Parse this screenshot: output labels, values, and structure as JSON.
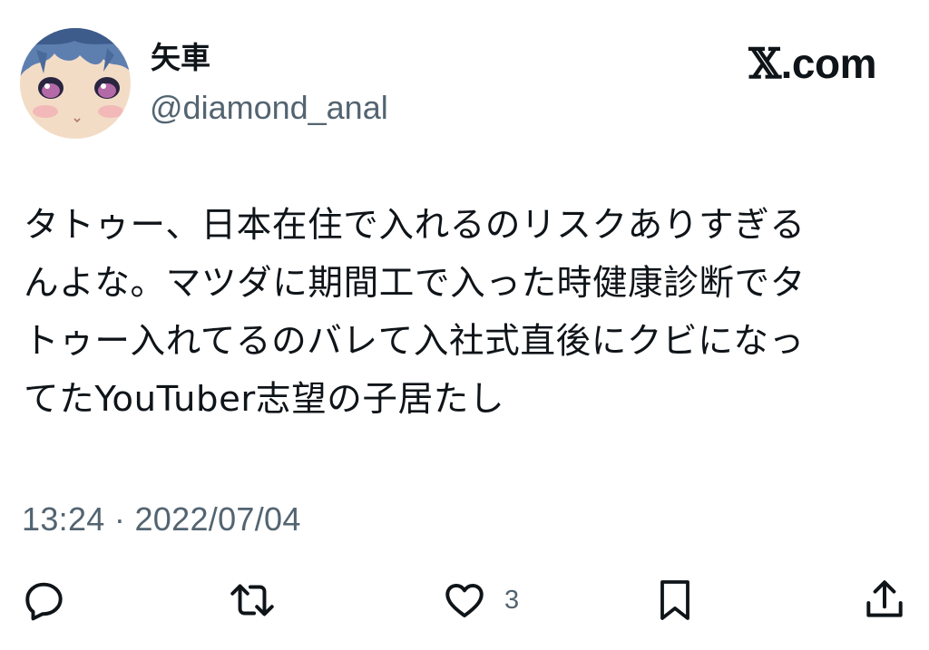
{
  "header": {
    "display_name": "矢車",
    "handle": "@diamond_anal",
    "site_mark": "𝕏",
    "site_suffix": ".com"
  },
  "tweet": {
    "lines": [
      "タトゥー、日本在住で入れるのリスクありすぎる",
      "んよな。マツダに期間工で入った時健康診断でタ",
      "トゥー入れてるのバレて入社式直後にクビになっ",
      "てたYouTuber志望の子居たし"
    ],
    "timestamp": "13:24 · 2022/07/04"
  },
  "actions": {
    "reply_icon": "reply-icon",
    "repost_icon": "repost-icon",
    "like_icon": "heart-icon",
    "like_count": "3",
    "bookmark_icon": "bookmark-icon",
    "share_icon": "share-icon"
  },
  "colors": {
    "text": "#0f1419",
    "secondary": "#536471",
    "background": "#ffffff"
  }
}
